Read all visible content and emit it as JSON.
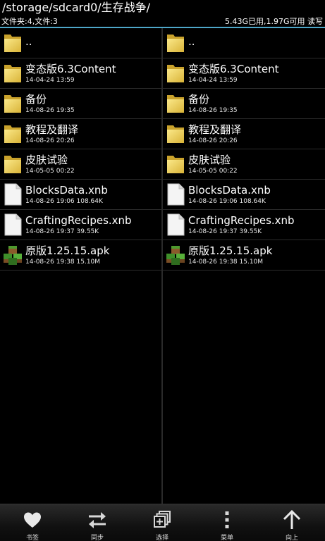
{
  "header": {
    "path": "/storage/sdcard0/生存战争/",
    "counts": "文件夹:4,文件:3",
    "storage": "5.43G已用,1.97G可用 读写"
  },
  "left_pane": {
    "items": [
      {
        "name": "..",
        "meta": "",
        "icon": "folder-icon"
      },
      {
        "name": "变态版6.3Content",
        "meta": "14-04-24 13:59",
        "icon": "folder-icon"
      },
      {
        "name": "备份",
        "meta": "14-08-26 19:35",
        "icon": "folder-icon"
      },
      {
        "name": "教程及翻译",
        "meta": "14-08-26 20:26",
        "icon": "folder-icon"
      },
      {
        "name": "皮肤试验",
        "meta": "14-05-05 00:22",
        "icon": "folder-icon"
      },
      {
        "name": "BlocksData.xnb",
        "meta": "14-08-26 19:06  108.64K",
        "icon": "file-icon"
      },
      {
        "name": "CraftingRecipes.xnb",
        "meta": "14-08-26 19:37  39.55K",
        "icon": "file-icon"
      },
      {
        "name": "原版1.25.15.apk",
        "meta": "14-08-26 19:38  15.10M",
        "icon": "apk-icon"
      }
    ]
  },
  "right_pane": {
    "items": [
      {
        "name": "..",
        "meta": "",
        "icon": "folder-icon"
      },
      {
        "name": "变态版6.3Content",
        "meta": "14-04-24 13:59",
        "icon": "folder-icon"
      },
      {
        "name": "备份",
        "meta": "14-08-26 19:35",
        "icon": "folder-icon"
      },
      {
        "name": "教程及翻译",
        "meta": "14-08-26 20:26",
        "icon": "folder-icon"
      },
      {
        "name": "皮肤试验",
        "meta": "14-05-05 00:22",
        "icon": "folder-icon"
      },
      {
        "name": "BlocksData.xnb",
        "meta": "14-08-26 19:06  108.64K",
        "icon": "file-icon"
      },
      {
        "name": "CraftingRecipes.xnb",
        "meta": "14-08-26 19:37  39.55K",
        "icon": "file-icon"
      },
      {
        "name": "原版1.25.15.apk",
        "meta": "14-08-26 19:38  15.10M",
        "icon": "apk-icon"
      }
    ]
  },
  "toolbar": {
    "bookmarks": {
      "label": "书签",
      "icon": "heart-icon"
    },
    "sync": {
      "label": "同步",
      "icon": "sync-arrows-icon"
    },
    "select": {
      "label": "选择",
      "icon": "multi-select-icon"
    },
    "menu": {
      "label": "菜单",
      "icon": "more-vertical-icon"
    },
    "up": {
      "label": "向上",
      "icon": "arrow-up-icon"
    }
  },
  "colors": {
    "background": "#000000",
    "accent_line": "#4ea7c9",
    "folder": "#f2d65c",
    "divider": "#2b2b2b"
  }
}
